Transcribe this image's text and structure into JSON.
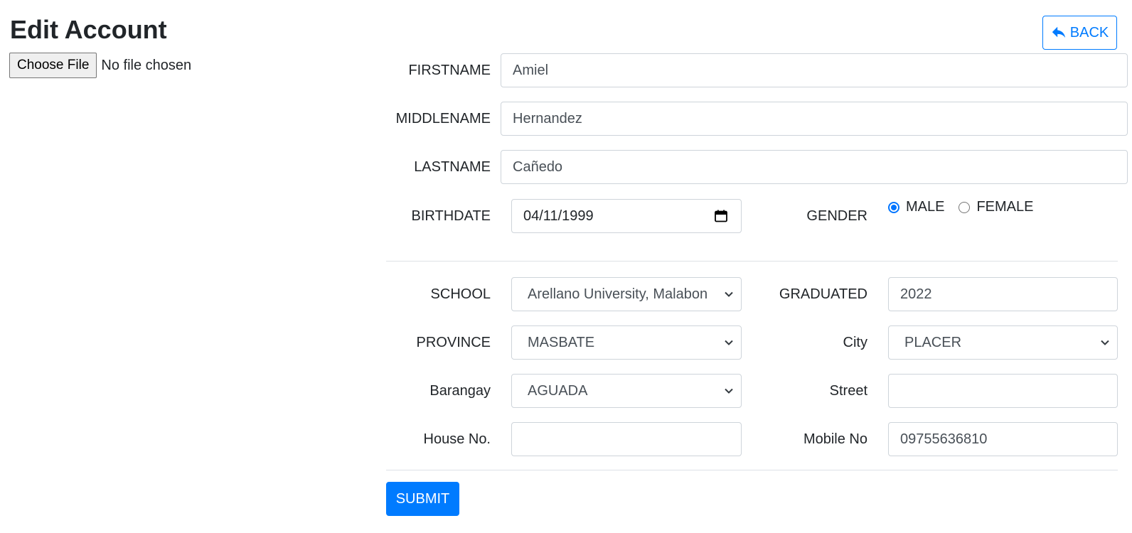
{
  "page": {
    "title": "Edit Account"
  },
  "file_input": {
    "button_label": "Choose File",
    "status": "No file chosen"
  },
  "back_button": {
    "label": "BACK",
    "icon": "reply-arrow-icon"
  },
  "form": {
    "firstname": {
      "label": "FIRSTNAME",
      "value": "Amiel"
    },
    "middlename": {
      "label": "MIDDLENAME",
      "value": "Hernandez"
    },
    "lastname": {
      "label": "LASTNAME",
      "value": "Cañedo"
    },
    "birthdate": {
      "label": "BIRTHDATE",
      "value": "04/11/1999"
    },
    "gender": {
      "label": "GENDER",
      "options": [
        {
          "label": "MALE",
          "checked": true
        },
        {
          "label": "FEMALE",
          "checked": false
        }
      ]
    },
    "school": {
      "label": "SCHOOL",
      "value": "Arellano University, Malabon"
    },
    "graduated": {
      "label": "GRADUATED",
      "value": "2022"
    },
    "province": {
      "label": "PROVINCE",
      "value": "MASBATE"
    },
    "city": {
      "label": "City",
      "value": "PLACER"
    },
    "barangay": {
      "label": "Barangay",
      "value": "AGUADA"
    },
    "street": {
      "label": "Street",
      "value": ""
    },
    "house_no": {
      "label": "House No.",
      "value": ""
    },
    "mobile_no": {
      "label": "Mobile No",
      "value": "09755636810"
    },
    "submit_label": "SUBMIT"
  },
  "colors": {
    "primary": "#007bff",
    "text": "#212529",
    "input_border": "#ced4da",
    "radio_checked": "#0075ff"
  }
}
